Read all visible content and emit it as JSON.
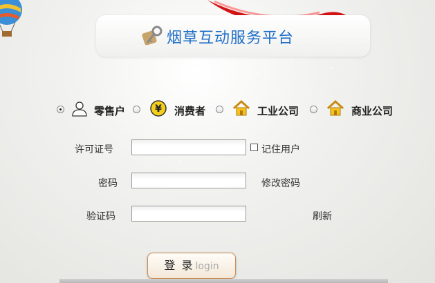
{
  "header": {
    "title": "烟草互动服务平台"
  },
  "roles": [
    {
      "label": "零售户",
      "icon": "user-icon",
      "checked": true
    },
    {
      "label": "消费者",
      "icon": "yen-coin-icon",
      "checked": false
    },
    {
      "label": "工业公司",
      "icon": "house-icon",
      "checked": false
    },
    {
      "label": "商业公司",
      "icon": "house-icon",
      "checked": false
    }
  ],
  "form": {
    "license_label": "许可证号",
    "license_value": "",
    "remember_label": "记住用户",
    "password_label": "密码",
    "password_value": "",
    "change_password_link": "修改密码",
    "captcha_label": "验证码",
    "captcha_value": "",
    "refresh_link": "刷新"
  },
  "login": {
    "label_cn": "登 录",
    "label_en": "login"
  },
  "colors": {
    "title": "#1f6fc8",
    "ribbon": "#e01818",
    "button_border": "#c98c5a"
  }
}
